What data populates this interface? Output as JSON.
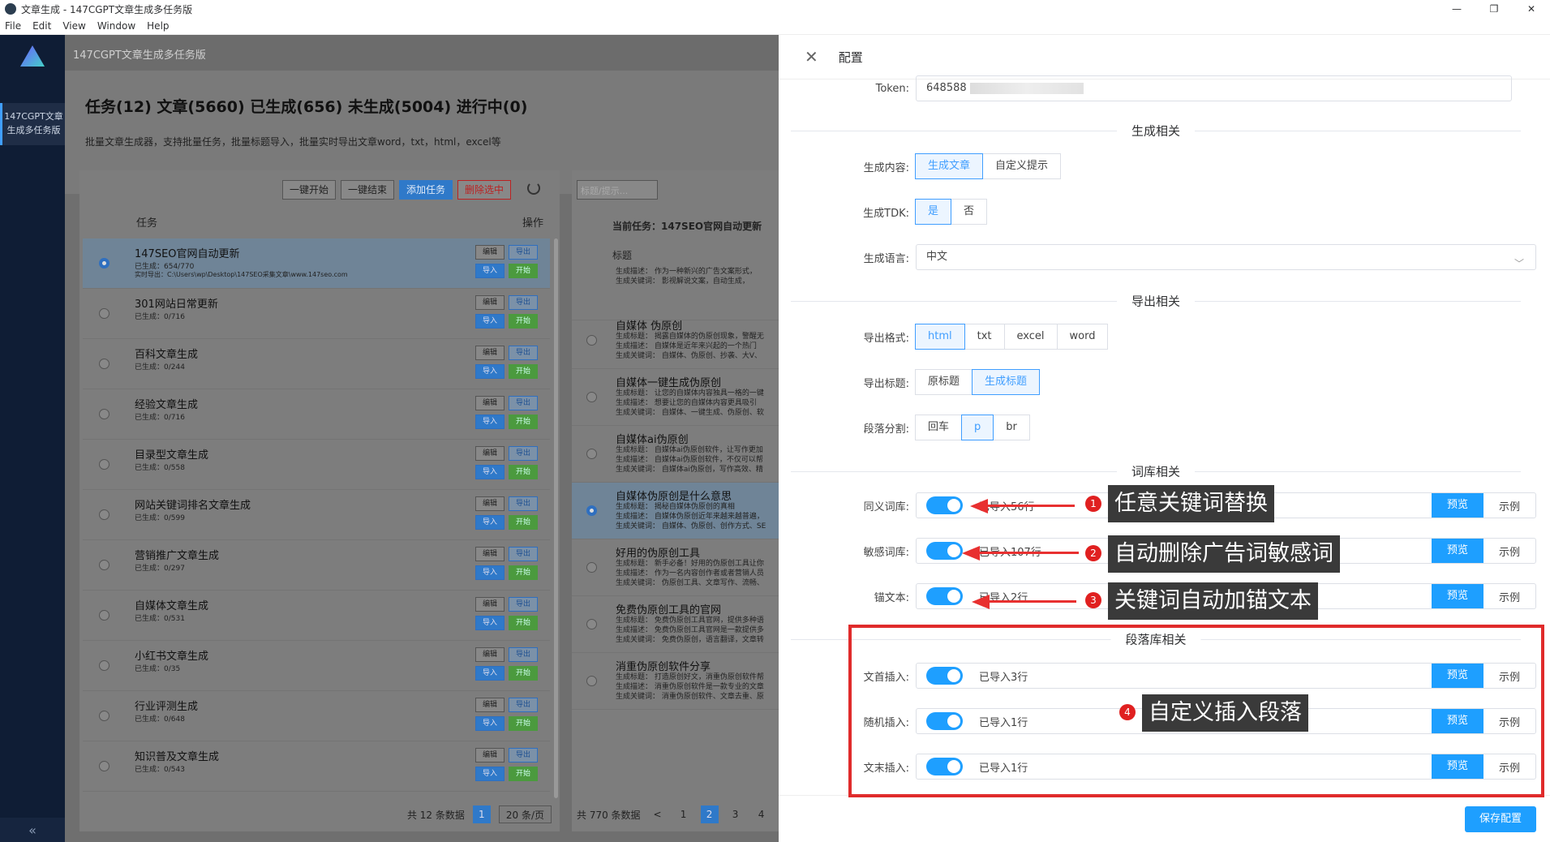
{
  "window": {
    "title": "文章生成 - 147CGPT文章生成多任务版",
    "min": "—",
    "restore": "❐",
    "close": "✕"
  },
  "menu": [
    "File",
    "Edit",
    "View",
    "Window",
    "Help"
  ],
  "sidebar": {
    "nav_label": "147CGPT文章生成多任务版",
    "collapse": "«"
  },
  "main": {
    "header": "147CGPT文章生成多任务版",
    "title": "任务(12) 文章(5660) 已生成(656) 未生成(5004) 进行中(0)",
    "desc": "批量文章生成器，支持批量任务，批量标题导入，批量实时导出文章word，txt，html，excel等"
  },
  "toolbar": {
    "start_all": "一键开始",
    "stop_all": "一键结束",
    "add_task": "添加任务",
    "delete_sel": "删除选中"
  },
  "columns": {
    "task": "任务",
    "op": "操作"
  },
  "ops": {
    "edit": "编辑",
    "export": "导出",
    "import": "导入",
    "start": "开始"
  },
  "tasks": [
    {
      "name": "147SEO官网自动更新",
      "progress": "已生成：654/770",
      "export_path": "实时导出：C:\\Users\\wp\\Desktop\\147SEO采集文章\\www.147seo.com",
      "selected": true
    },
    {
      "name": "301网站日常更新",
      "progress": "已生成：0/716"
    },
    {
      "name": "百科文章生成",
      "progress": "已生成：0/244"
    },
    {
      "name": "经验文章生成",
      "progress": "已生成：0/716"
    },
    {
      "name": "目录型文章生成",
      "progress": "已生成：0/558"
    },
    {
      "name": "网站关键词排名文章生成",
      "progress": "已生成：0/599"
    },
    {
      "name": "营销推广文章生成",
      "progress": "已生成：0/297"
    },
    {
      "name": "自媒体文章生成",
      "progress": "已生成：0/531"
    },
    {
      "name": "小红书文章生成",
      "progress": "已生成：0/35"
    },
    {
      "name": "行业评测生成",
      "progress": "已生成：0/648"
    },
    {
      "name": "知识普及文章生成",
      "progress": "已生成：0/543"
    }
  ],
  "pagerL": {
    "total": "共 12 条数据",
    "page": "1",
    "size": "20 条/页"
  },
  "right": {
    "search_ph": "标题/提示...",
    "current": "当前任务：147SEO官网自动更新",
    "col_title": "标题",
    "articles": [
      {
        "t": "",
        "d1": "生成描述：  作为一种新兴的广告文案形式，",
        "d2": "生成关键词：  影视解说文案，自动生成，  "
      },
      {
        "t": "自媒体 伪原创",
        "d1": "生成标题：  揭露自媒体的伪原创现象，警醒无",
        "d2": "生成描述：  自媒体是近年来兴起的一个热门",
        "d3": "生成关键词：  自媒体、伪原创、抄袭、大V、"
      },
      {
        "t": "自媒体一键生成伪原创",
        "d1": "生成标题：  让您的自媒体内容独具一格的一键",
        "d2": "生成描述：  想要让您的自媒体内容更具吸引",
        "d3": "生成关键词：  自媒体、一键生成、伪原创、软"
      },
      {
        "t": "自媒体ai伪原创",
        "d1": "生成标题：  自媒体ai伪原创软件，让写作更加",
        "d2": "生成描述：  自媒体ai伪原创软件，不仅可以帮",
        "d3": "生成关键词：  自媒体ai伪原创，写作高效、精"
      },
      {
        "t": "自媒体伪原创是什么意思",
        "d1": "生成标题：  揭秘自媒体伪原创的真相",
        "d2": "生成描述：  自媒体伪原创近年来越来越普遍，",
        "d3": "生成关键词：  自媒体、伪原创、创作方式、SE",
        "sel": true
      },
      {
        "t": "好用的伪原创工具",
        "d1": "生成标题：  新手必备！好用的伪原创工具让你",
        "d2": "生成描述：  作为一名内容创作者或者营销人员",
        "d3": "生成关键词：  伪原创工具、文章写作、流畅、"
      },
      {
        "t": "免费伪原创工具的官网",
        "d1": "生成标题：  免费伪原创工具官网，提供多种语",
        "d2": "生成描述：  免费伪原创工具官网是一款提供多",
        "d3": "生成关键词：  免费伪原创，语言翻译，文章转"
      },
      {
        "t": "消重伪原创软件分享",
        "d1": "生成标题：  打造原创好文，消重伪原创软件帮",
        "d2": "生成描述：  消重伪原创软件是一款专业的文章",
        "d3": "生成关键词：  消重伪原创软件、文章去重、原"
      }
    ],
    "pager": {
      "total": "共 770 条数据",
      "prev": "<",
      "pages": [
        "1",
        "2",
        "3",
        "4"
      ],
      "active": "2"
    }
  },
  "drawer": {
    "close": "✕",
    "title": "配置",
    "token_label": "Token:",
    "token_value": "648588",
    "sec_gen": "生成相关",
    "gen_content_label": "生成内容:",
    "gen_content_opts": [
      "生成文章",
      "自定义提示"
    ],
    "gen_tdk_label": "生成TDK:",
    "gen_tdk_opts": [
      "是",
      "否"
    ],
    "lang_label": "生成语言:",
    "lang_value": "中文",
    "sec_export": "导出相关",
    "fmt_label": "导出格式:",
    "fmt_opts": [
      "html",
      "txt",
      "excel",
      "word"
    ],
    "etitle_label": "导出标题:",
    "etitle_opts": [
      "原标题",
      "生成标题"
    ],
    "para_label": "段落分割:",
    "para_opts": [
      "回车",
      "p",
      "br"
    ],
    "sec_lex": "词库相关",
    "syn_label": "同义词库:",
    "syn_text": "已导入56行",
    "sens_label": "敏感词库:",
    "sens_text": "已导入107行",
    "anchor_label": "锚文本:",
    "anchor_text": "已导入2行",
    "sec_para": "段落库相关",
    "head_label": "文首插入:",
    "head_text": "已导入3行",
    "rand_label": "随机插入:",
    "rand_text": "已导入1行",
    "tail_label": "文末插入:",
    "tail_text": "已导入1行",
    "preview": "预览",
    "example": "示例",
    "save": "保存配置"
  },
  "annotations": [
    {
      "n": "1",
      "text": "任意关键词替换"
    },
    {
      "n": "2",
      "text": "自动删除广告词敏感词"
    },
    {
      "n": "3",
      "text": "关键词自动加锚文本"
    },
    {
      "n": "4",
      "text": "自定义插入段落"
    }
  ],
  "colors": {
    "sidebar": "#0f1d35",
    "accent": "#1e9fff",
    "annotation_red": "#e02b2b"
  }
}
